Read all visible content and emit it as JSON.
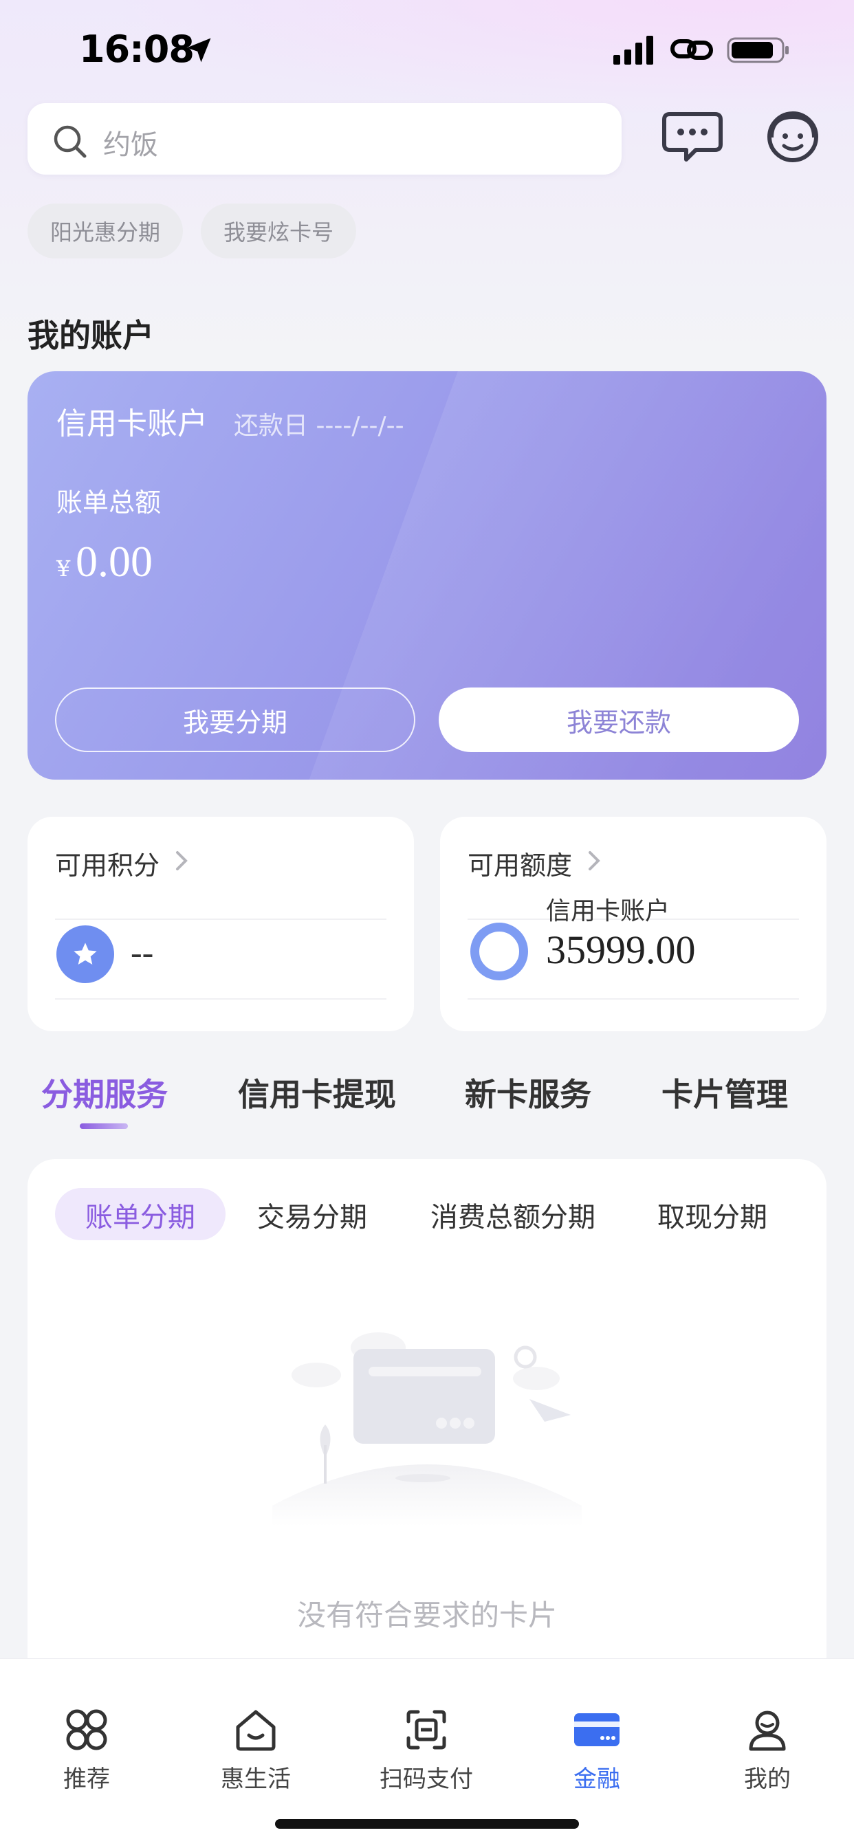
{
  "status_bar": {
    "time": "16:08"
  },
  "search": {
    "placeholder": "约饭"
  },
  "chips": [
    "阳光惠分期",
    "我要炫卡号"
  ],
  "account_section": {
    "title": "我的账户"
  },
  "credit_card": {
    "title": "信用卡账户",
    "due_label": "还款日 ----/--/--",
    "bill_label": "账单总额",
    "currency": "¥",
    "amount": "0.00",
    "installment_button": "我要分期",
    "repay_button": "我要还款"
  },
  "points_card": {
    "title": "可用积分",
    "value": "--"
  },
  "limit_card": {
    "title": "可用额度",
    "sub_label": "信用卡账户",
    "value": "35999.00"
  },
  "tabs": [
    "分期服务",
    "信用卡提现",
    "新卡服务",
    "卡片管理"
  ],
  "subtabs": [
    "账单分期",
    "交易分期",
    "消费总额分期",
    "取现分期"
  ],
  "empty_state": {
    "text": "没有符合要求的卡片"
  },
  "bottom_nav": [
    {
      "label": "推荐",
      "icon": "grid-icon"
    },
    {
      "label": "惠生活",
      "icon": "home-icon"
    },
    {
      "label": "扫码支付",
      "icon": "scan-icon"
    },
    {
      "label": "金融",
      "icon": "card-icon",
      "active": true
    },
    {
      "label": "我的",
      "icon": "user-icon"
    }
  ],
  "colors": {
    "accent": "#8a5ce0",
    "nav_active": "#3b6ef0",
    "card_start": "#a8b0f2",
    "card_end": "#9283e0"
  }
}
